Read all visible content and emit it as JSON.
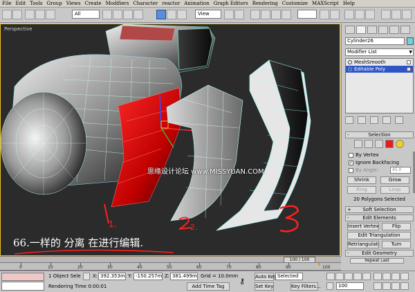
{
  "menu": [
    "File",
    "Edit",
    "Tools",
    "Group",
    "Views",
    "Create",
    "Modifiers",
    "Character",
    "reactor",
    "Animation",
    "Graph Editors",
    "Rendering",
    "Customize",
    "MAXScript",
    "Help"
  ],
  "toolbar": {
    "selection_filter": "All",
    "reference_coord": "View"
  },
  "viewport": {
    "label": "Perspective",
    "caption": "66.一样的 分离 在进行编辑.",
    "watermark": "思缘设计论坛 www.MISSYUAN.COM",
    "annotations": [
      "1.",
      "2.",
      "3"
    ]
  },
  "command_panel": {
    "object_name": "Cylinder26",
    "object_color": "#6fd0e0",
    "modifier_list": "Modifier List",
    "stack": [
      {
        "label": "MeshSmooth",
        "selected": false
      },
      {
        "label": "Editable Poly",
        "selected": true
      }
    ],
    "selection": {
      "title": "Selection",
      "by_vertex": "By Vertex",
      "ignore_backfacing": "Ignore Backfacing",
      "by_angle": "By Angle:",
      "angle_value": "45.0",
      "shrink": "Shrink",
      "grow": "Grow",
      "ring": "Ring",
      "loop": "Loop",
      "status": "20 Polygons Selected"
    },
    "soft_selection": "Soft Selection",
    "edit_elements": {
      "title": "Edit Elements",
      "insert_vertex": "Insert Vertex",
      "flip": "Flip",
      "edit_triangulation": "Edit Triangulation",
      "retriangulate": "Retriangulate",
      "turn": "Turn"
    },
    "edit_geometry": {
      "title": "Edit Geometry",
      "repeat_last": "Repeat Last"
    }
  },
  "timeline": {
    "slider": "100 / 100",
    "ticks": [
      "0",
      "10",
      "20",
      "30",
      "40",
      "50",
      "60",
      "70",
      "80",
      "90",
      "100"
    ]
  },
  "status": {
    "selection": "1 Object Sele",
    "x_label": "X:",
    "x_value": "392.353m",
    "y_label": "Y:",
    "y_value": "-150.257m",
    "z_label": "Z:",
    "z_value": "381.499m",
    "grid": "Grid = 10.0mm",
    "rendering_time": "Rendering Time  0:00:01",
    "add_time_tag": "Add Time Tag",
    "auto_key": "Auto Key",
    "auto_key_mode": "Selected",
    "set_key": "Set Key",
    "key_filters": "Key Filters...",
    "frame": "100"
  }
}
